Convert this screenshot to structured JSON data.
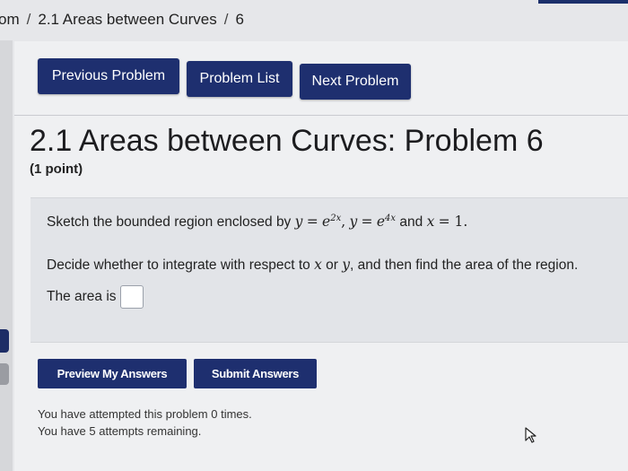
{
  "breadcrumb": {
    "root": "om",
    "separator": "/",
    "set": "2.1 Areas between Curves",
    "problem": "6"
  },
  "nav": {
    "previous_label": "Previous Problem",
    "list_label": "Problem List",
    "next_label": "Next Problem"
  },
  "problem": {
    "title": "2.1 Areas between Curves: Problem 6",
    "points": "(1 point)",
    "sketch_prefix": "Sketch the bounded region enclosed by",
    "sketch_and": "and",
    "decide_prefix": "Decide whether to integrate with respect to",
    "decide_or": "or",
    "decide_suffix": ", and then find the area of the region.",
    "answer_label": "The area is",
    "answer_value": ""
  },
  "actions": {
    "preview_label": "Preview My Answers",
    "submit_label": "Submit Answers"
  },
  "status": {
    "attempted_prefix": "You have attempted this problem",
    "attempted_count": "0",
    "attempted_suffix": "times.",
    "remaining_prefix": "You have",
    "remaining_count": "5",
    "remaining_suffix": "attempts remaining."
  },
  "colors": {
    "button_bg": "#1e2f6f",
    "page_bg": "#eff0f2",
    "problem_bg": "#e2e4e8"
  },
  "icons": {
    "cursor": "mouse-pointer-icon"
  }
}
